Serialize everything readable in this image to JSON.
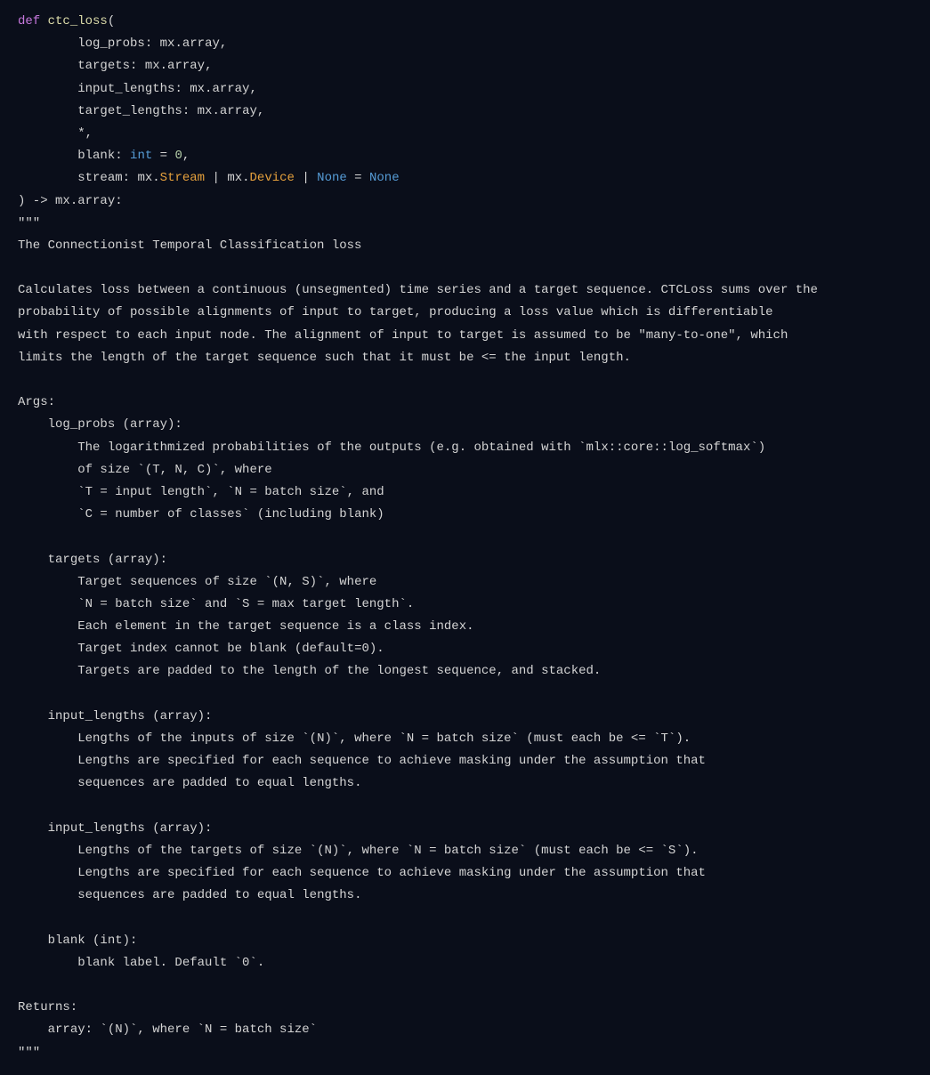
{
  "signature": {
    "def": "def",
    "fn_name": "ctc_loss",
    "params": {
      "p1_name": "log_probs",
      "p1_type": "mx.array",
      "p2_name": "targets",
      "p2_type": "mx.array",
      "p3_name": "input_lengths",
      "p3_type": "mx.array",
      "p4_name": "target_lengths",
      "p4_type": "mx.array",
      "star": "*",
      "p5_name": "blank",
      "p5_type": "int",
      "p5_default": "0",
      "p6_name": "stream",
      "p6_type_mx": "mx.",
      "p6_type_stream": "Stream",
      "p6_type_device": "Device",
      "p6_type_none": "None",
      "p6_default": "None"
    },
    "return_prefix": ") -> mx.array:",
    "arrow": " -> ",
    "return_type": "mx.array"
  },
  "docstring": {
    "open": "\"\"\"",
    "title": "The Connectionist Temporal Classification loss",
    "desc1": "Calculates loss between a continuous (unsegmented) time series and a target sequence. CTCLoss sums over the",
    "desc2": "probability of possible alignments of input to target, producing a loss value which is differentiable",
    "desc3": "with respect to each input node. The alignment of input to target is assumed to be \"many-to-one\", which",
    "desc4": "limits the length of the target sequence such that it must be <= the input length.",
    "args_header": "Args:",
    "arg1_name": "log_probs (array):",
    "arg1_l1": "The logarithmized probabilities of the outputs (e.g. obtained with `mlx::core::log_softmax`)",
    "arg1_l2": "of size `(T, N, C)`, where",
    "arg1_l3": "`T = input length`, `N = batch size`, and",
    "arg1_l4": "`C = number of classes` (including blank)",
    "arg2_name": "targets (array):",
    "arg2_l1": "Target sequences of size `(N, S)`, where",
    "arg2_l2": "`N = batch size` and `S = max target length`.",
    "arg2_l3": "Each element in the target sequence is a class index.",
    "arg2_l4": "Target index cannot be blank (default=0).",
    "arg2_l5": "Targets are padded to the length of the longest sequence, and stacked.",
    "arg3_name": "input_lengths (array):",
    "arg3_l1": "Lengths of the inputs of size `(N)`, where `N = batch size` (must each be <= `T`).",
    "arg3_l2": "Lengths are specified for each sequence to achieve masking under the assumption that",
    "arg3_l3": "sequences are padded to equal lengths.",
    "arg4_name": "input_lengths (array):",
    "arg4_l1": "Lengths of the targets of size `(N)`, where `N = batch size` (must each be <= `S`).",
    "arg4_l2": "Lengths are specified for each sequence to achieve masking under the assumption that",
    "arg4_l3": "sequences are padded to equal lengths.",
    "arg5_name": "blank (int):",
    "arg5_l1": "blank label. Default `0`.",
    "returns_header": "Returns:",
    "returns_l1": "array: `(N)`, where `N = batch size`",
    "close": "\"\"\""
  }
}
